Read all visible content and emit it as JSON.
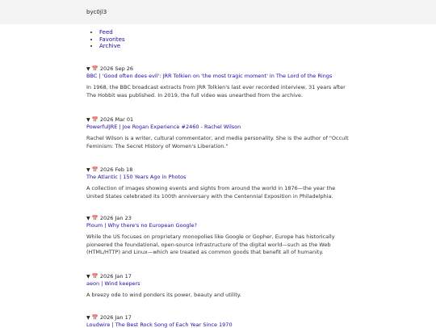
{
  "site": {
    "title": "byc0jl3"
  },
  "nav": [
    {
      "label": "Feed"
    },
    {
      "label": "Favorites"
    },
    {
      "label": "Archive"
    }
  ],
  "entries": [
    {
      "toggle": "▼",
      "icon": "📅",
      "date": "2026 Sep 26",
      "link": "BBC | 'Good often does evil': JRR Tolkien on 'the most tragic moment' in The Lord of the Rings",
      "desc": "In 1968, the BBC broadcast extracts from JRR Tolkien's last ever recorded interview, 31 years after The Hobbit was published. In 2019, the full video was unearthed from the archive."
    },
    {
      "toggle": "▼",
      "icon": "📅",
      "date": "2026 Mar 01",
      "link": "PowerfulJRE | Joe Rogan Experience #2460 - Rachel Wilson",
      "desc": "Rachel Wilson is a writer, cultural commentator, and media personality. She is the author of \"Occult Feminism: The Secret History of Women's Liberation.\""
    },
    {
      "toggle": "▼",
      "icon": "📅",
      "date": "2026 Feb 18",
      "link": "The Atlantic | 150 Years Ago in Photos",
      "desc": "A collection of images showing events and sights from around the world in 1876—the year the United States celebrated its 100th anniversary with the Centennial Exposition in Philadelphia."
    },
    {
      "toggle": "▼",
      "icon": "📅",
      "date": "2026 Jan 23",
      "link": "Ploum | Why there's no European Google?",
      "desc": "While the US focuses on proprietary monopolies like Google or Gopher, Europe has historically pioneered the foundational, open-source infrastructure of the digital world—such as the Web (HTML/HTTP) and Linux—which are treated as common goods that benefit all of humanity."
    },
    {
      "toggle": "▼",
      "icon": "📅",
      "date": "2026 Jan 17",
      "link": "aeon | Wind keepers",
      "desc": "A breezy ode to wind ponders its power, beauty and utility."
    },
    {
      "toggle": "▼",
      "icon": "📅",
      "date": "2026 Jan 17",
      "link": "Loudwire | The Best Rock Song of Each Year Since 1970",
      "desc": ""
    }
  ]
}
